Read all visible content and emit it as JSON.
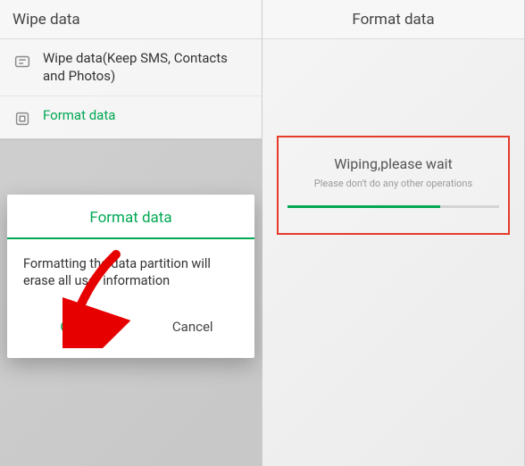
{
  "left": {
    "header": "Wipe data",
    "items": [
      {
        "label": "Wipe data(Keep SMS, Contacts and Photos)"
      },
      {
        "label": "Format data"
      }
    ],
    "dialog": {
      "title": "Format data",
      "body": "Formatting the data partition will erase all user information",
      "ok": "OK",
      "cancel": "Cancel"
    }
  },
  "right": {
    "header": "Format data",
    "progress": {
      "title": "Wiping,please wait",
      "sub": "Please don't do any other operations"
    }
  }
}
